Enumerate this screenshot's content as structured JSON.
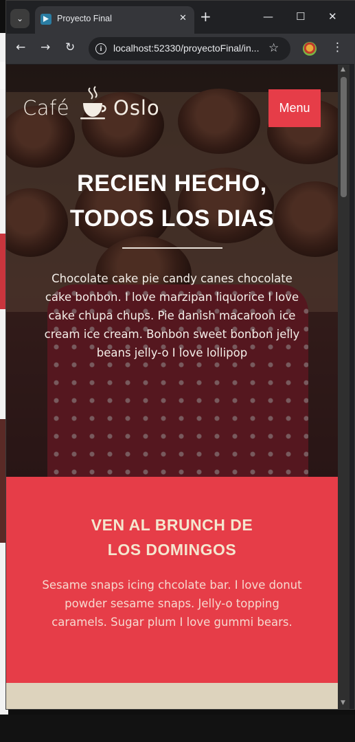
{
  "browser": {
    "tab_title": "Proyecto Final",
    "tab_close": "✕",
    "new_tab": "+",
    "url": "localhost:52330/proyectoFinal/in...",
    "window_controls": {
      "minimize": "—",
      "maximize": "☐",
      "close": "✕"
    },
    "nav": {
      "back": "←",
      "forward": "→",
      "reload": "↻",
      "bookmark": "☆",
      "menu": "⋮"
    },
    "icons": [
      "tab-search-icon",
      "favicon-icon",
      "back-icon",
      "forward-icon",
      "reload-icon",
      "site-info-icon",
      "bookmark-star-icon",
      "profile-icon",
      "kebab-menu-icon"
    ]
  },
  "site": {
    "brand": {
      "part1": "Café",
      "part2": "Oslo"
    },
    "menu_label": "Menu",
    "hero": {
      "title_line1": "RECIEN HECHO,",
      "title_line2": "TODOS LOS DIAS",
      "text": "Chocolate cake pie candy canes chocolate cake bonbon. I love marzipan liquorice I love cake chupa chups. Pie danish macaroon ice cream ice cream. Bonbon sweet bonbon jelly beans jelly-o I love lollipop"
    },
    "brunch": {
      "title_line1": "VEN AL BRUNCH DE",
      "title_line2": "LOS DOMINGOS",
      "text": "Sesame snaps icing chcolate bar. I love donut powder sesame snaps. Jelly-o topping caramels. Sugar plum I love gummi bears."
    }
  },
  "colors": {
    "accent_red": "#e63d48",
    "cream": "#f4e6cf",
    "beige": "#ddd3bd",
    "chrome_dark": "#202124",
    "chrome_toolbar": "#35363a"
  }
}
